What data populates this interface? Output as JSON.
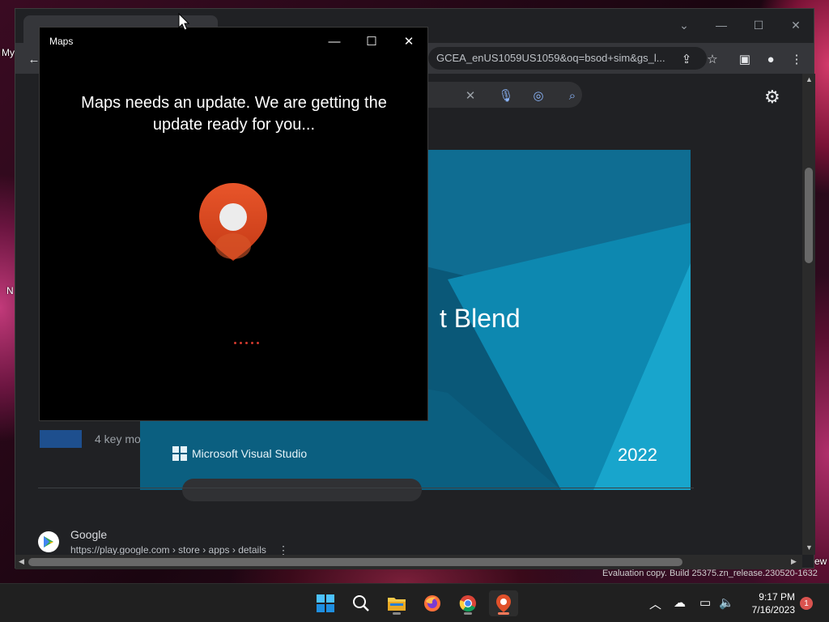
{
  "desktop": {
    "left_labels": [
      "My",
      "N"
    ],
    "right_label": "ew"
  },
  "maps_window": {
    "title": "Maps",
    "message": "Maps needs an update. We are getting the update ready for you...",
    "accent_color": "#d4491f"
  },
  "browser": {
    "address_text": "GCEA_enUS1059US1059&oq=bsod+sim&gs_l...",
    "image": {
      "title_fragment": "t Blend",
      "brand": "Microsoft Visual Studio",
      "year": "2022"
    },
    "result_partial_text": "4 key mo",
    "google_result": {
      "title": "Google",
      "url": "https://play.google.com › store › apps › details",
      "more_icon": "more-vert-icon"
    }
  },
  "watermark": "Evaluation copy. Build 25375.zn_release.230520-1632",
  "taskbar": {
    "apps": [
      "start-icon",
      "search-icon",
      "file-explorer-icon",
      "firefox-icon",
      "chrome-icon",
      "maps-icon"
    ],
    "time": "9:17 PM",
    "date": "7/16/2023",
    "notification_count": "1"
  }
}
